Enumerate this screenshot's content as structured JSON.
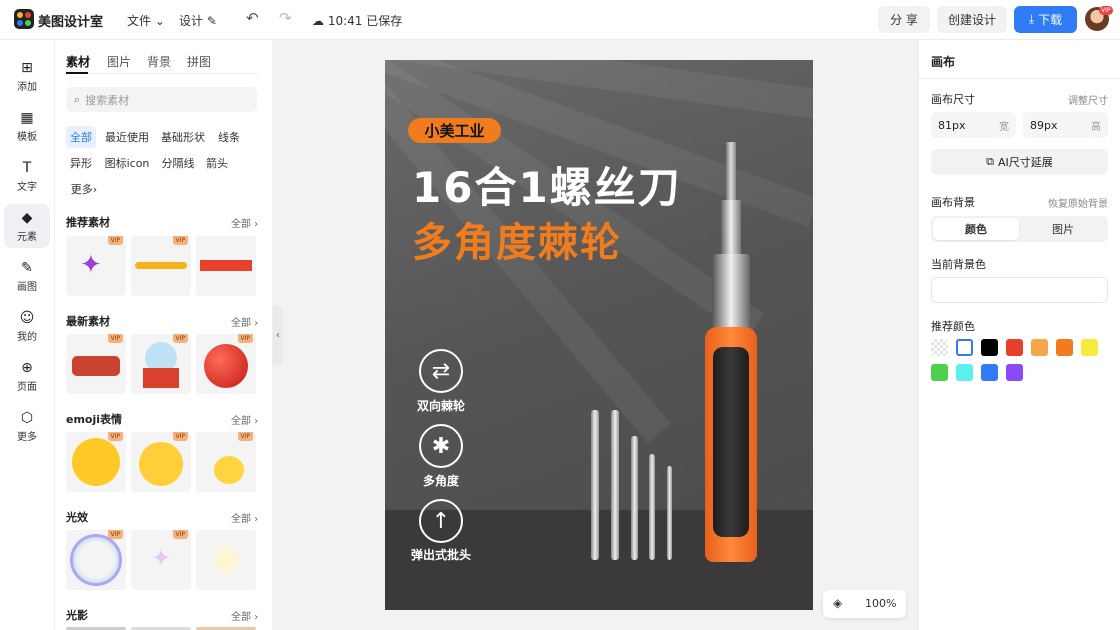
{
  "app": {
    "name": "美图设计室"
  },
  "topbar": {
    "file_menu": "文件",
    "design_menu": "设计",
    "save_status": "10:41 已保存",
    "share_label": "分 享",
    "create_label": "创建设计",
    "download_label": "下载",
    "avatar_badge": "VIP"
  },
  "rail": [
    {
      "label": "添加",
      "icon": "plus-square-icon",
      "glyph": "⊞"
    },
    {
      "label": "模板",
      "icon": "template-icon",
      "glyph": "▦"
    },
    {
      "label": "文字",
      "icon": "text-icon",
      "glyph": "T"
    },
    {
      "label": "元素",
      "icon": "shapes-icon",
      "glyph": "◆"
    },
    {
      "label": "画图",
      "icon": "draw-icon",
      "glyph": "✎"
    },
    {
      "label": "我的",
      "icon": "user-icon",
      "glyph": "☺"
    },
    {
      "label": "页面",
      "icon": "page-add-icon",
      "glyph": "⊕"
    },
    {
      "label": "更多",
      "icon": "cube-icon",
      "glyph": "⬡"
    }
  ],
  "panel": {
    "tabs": [
      "素材",
      "图片",
      "背景",
      "拼图"
    ],
    "search_placeholder": "搜索素材",
    "chips": [
      "全部",
      "最近使用",
      "基础形状",
      "线条",
      "异形",
      "图标icon",
      "分隔线",
      "箭头",
      "更多"
    ],
    "all_label": "全部",
    "vip": "VIP",
    "sections": [
      {
        "title": "推荐素材"
      },
      {
        "title": "最新素材"
      },
      {
        "title": "emoji表情"
      },
      {
        "title": "光效"
      },
      {
        "title": "光影"
      }
    ]
  },
  "poster": {
    "tag": "小美工业",
    "headline1": "16合1螺丝刀",
    "headline2": "多角度棘轮",
    "features": [
      {
        "label": "双向棘轮",
        "icon": "swap-arrows-icon",
        "glyph": "⇄"
      },
      {
        "label": "多角度",
        "icon": "asterisk-icon",
        "glyph": "✱"
      },
      {
        "label": "弹出式批头",
        "icon": "arrow-up-icon",
        "glyph": "↑"
      }
    ]
  },
  "zoom": {
    "level": "100%"
  },
  "right": {
    "title": "画布",
    "size_label": "画布尺寸",
    "resize_link": "调整尺寸",
    "width_value": "81px",
    "width_unit": "宽",
    "height_value": "89px",
    "height_unit": "高",
    "ai_extend": "AI尺寸延展",
    "bg_label": "画布背景",
    "restore_link": "恢复原始背景",
    "seg_color": "颜色",
    "seg_image": "图片",
    "current_bg": "当前背景色",
    "recommended": "推荐颜色",
    "swatches": [
      "transparent",
      "#ffffff",
      "#000000",
      "#e8412b",
      "#f5a64a",
      "#f07c1e",
      "#f7ec3e",
      "#4fd04a",
      "#5ef0ee",
      "#2f7cf6",
      "#8a4af6"
    ]
  }
}
